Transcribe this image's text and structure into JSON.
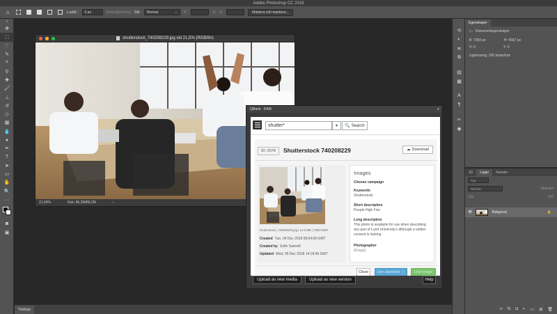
{
  "app": {
    "title": "Adobe Photoshop CC 2019"
  },
  "options_bar": {
    "feather_label": "Luddl.:",
    "feather_value": "0 px",
    "antialias_label": "Kantutjämning",
    "style_label": "Stil:",
    "style_value": "Normal",
    "width_label": "B:",
    "height_label": "H:",
    "select_mask_button": "Markera och maskera..."
  },
  "document": {
    "title": "shutterstock_740208229.jpg vid 21,5% (RGB/8#)",
    "zoom": "21,54%",
    "doc_size": "Dok: 86,2M/86,2M"
  },
  "properties_panel": {
    "tab": "Egenskaper",
    "section": "Dokumentegenskaper",
    "width": "B: 7360 px",
    "height": "H: 4567 px",
    "x": "X: 0",
    "y": "Y: 0",
    "resolution": "Upplösning: 300 pixlar/tum"
  },
  "layers_panel": {
    "tabs": [
      "3D",
      "Lager",
      "Kanaler"
    ],
    "active_tab": "Lager",
    "kind_filter": "Typ",
    "blend_mode": "Normal",
    "opacity_label": "Opacitet:",
    "lock_label": "Lås:",
    "fill_label": "Fyll:",
    "layer_name": "Bakgrund"
  },
  "timeline": {
    "tab": "Tidslinje"
  },
  "qbank": {
    "title": "QBank - DAM",
    "search_value": "shutter*",
    "search_button": "Search",
    "asset_id": "ID: 2078",
    "asset_title": "Shutterstock 740208229",
    "download_button": "Download",
    "file_info": "shutterstock_740208229.jpg | 14.5 MB | 7360×4567",
    "created_label": "Created",
    "created_value": "Tue, 04 Dec 2018 08:04:09 GMT",
    "created_by_label": "Created by",
    "created_by_value": "Sofie Samrell",
    "updated_label": "Updated",
    "updated_value": "Wed, 05 Dec 2018 14:18:46 GMT",
    "images_heading": "Images",
    "choose_campaign": "Choose campaign",
    "keywords_label": "Keywords",
    "keywords_value": "Shutterstock",
    "short_desc_label": "Short description",
    "short_desc_value": "People High Five",
    "long_desc_label": "Long description",
    "long_desc_value": "This photo is available for use when describing any part of Lund University's although a written consent is lacking.",
    "photographer_label": "Photographer",
    "photographer_value": "(Empty)",
    "close_button": "Close",
    "apply_button": "Use standard",
    "save_button": "Use image",
    "upload_media_button": "Upload as new media",
    "upload_version_button": "Upload as new version",
    "help_button": "Help"
  },
  "colors": {
    "accent_blue": "#5aa7d7",
    "accent_green": "#7cc66e",
    "panel_gray": "#535353"
  }
}
